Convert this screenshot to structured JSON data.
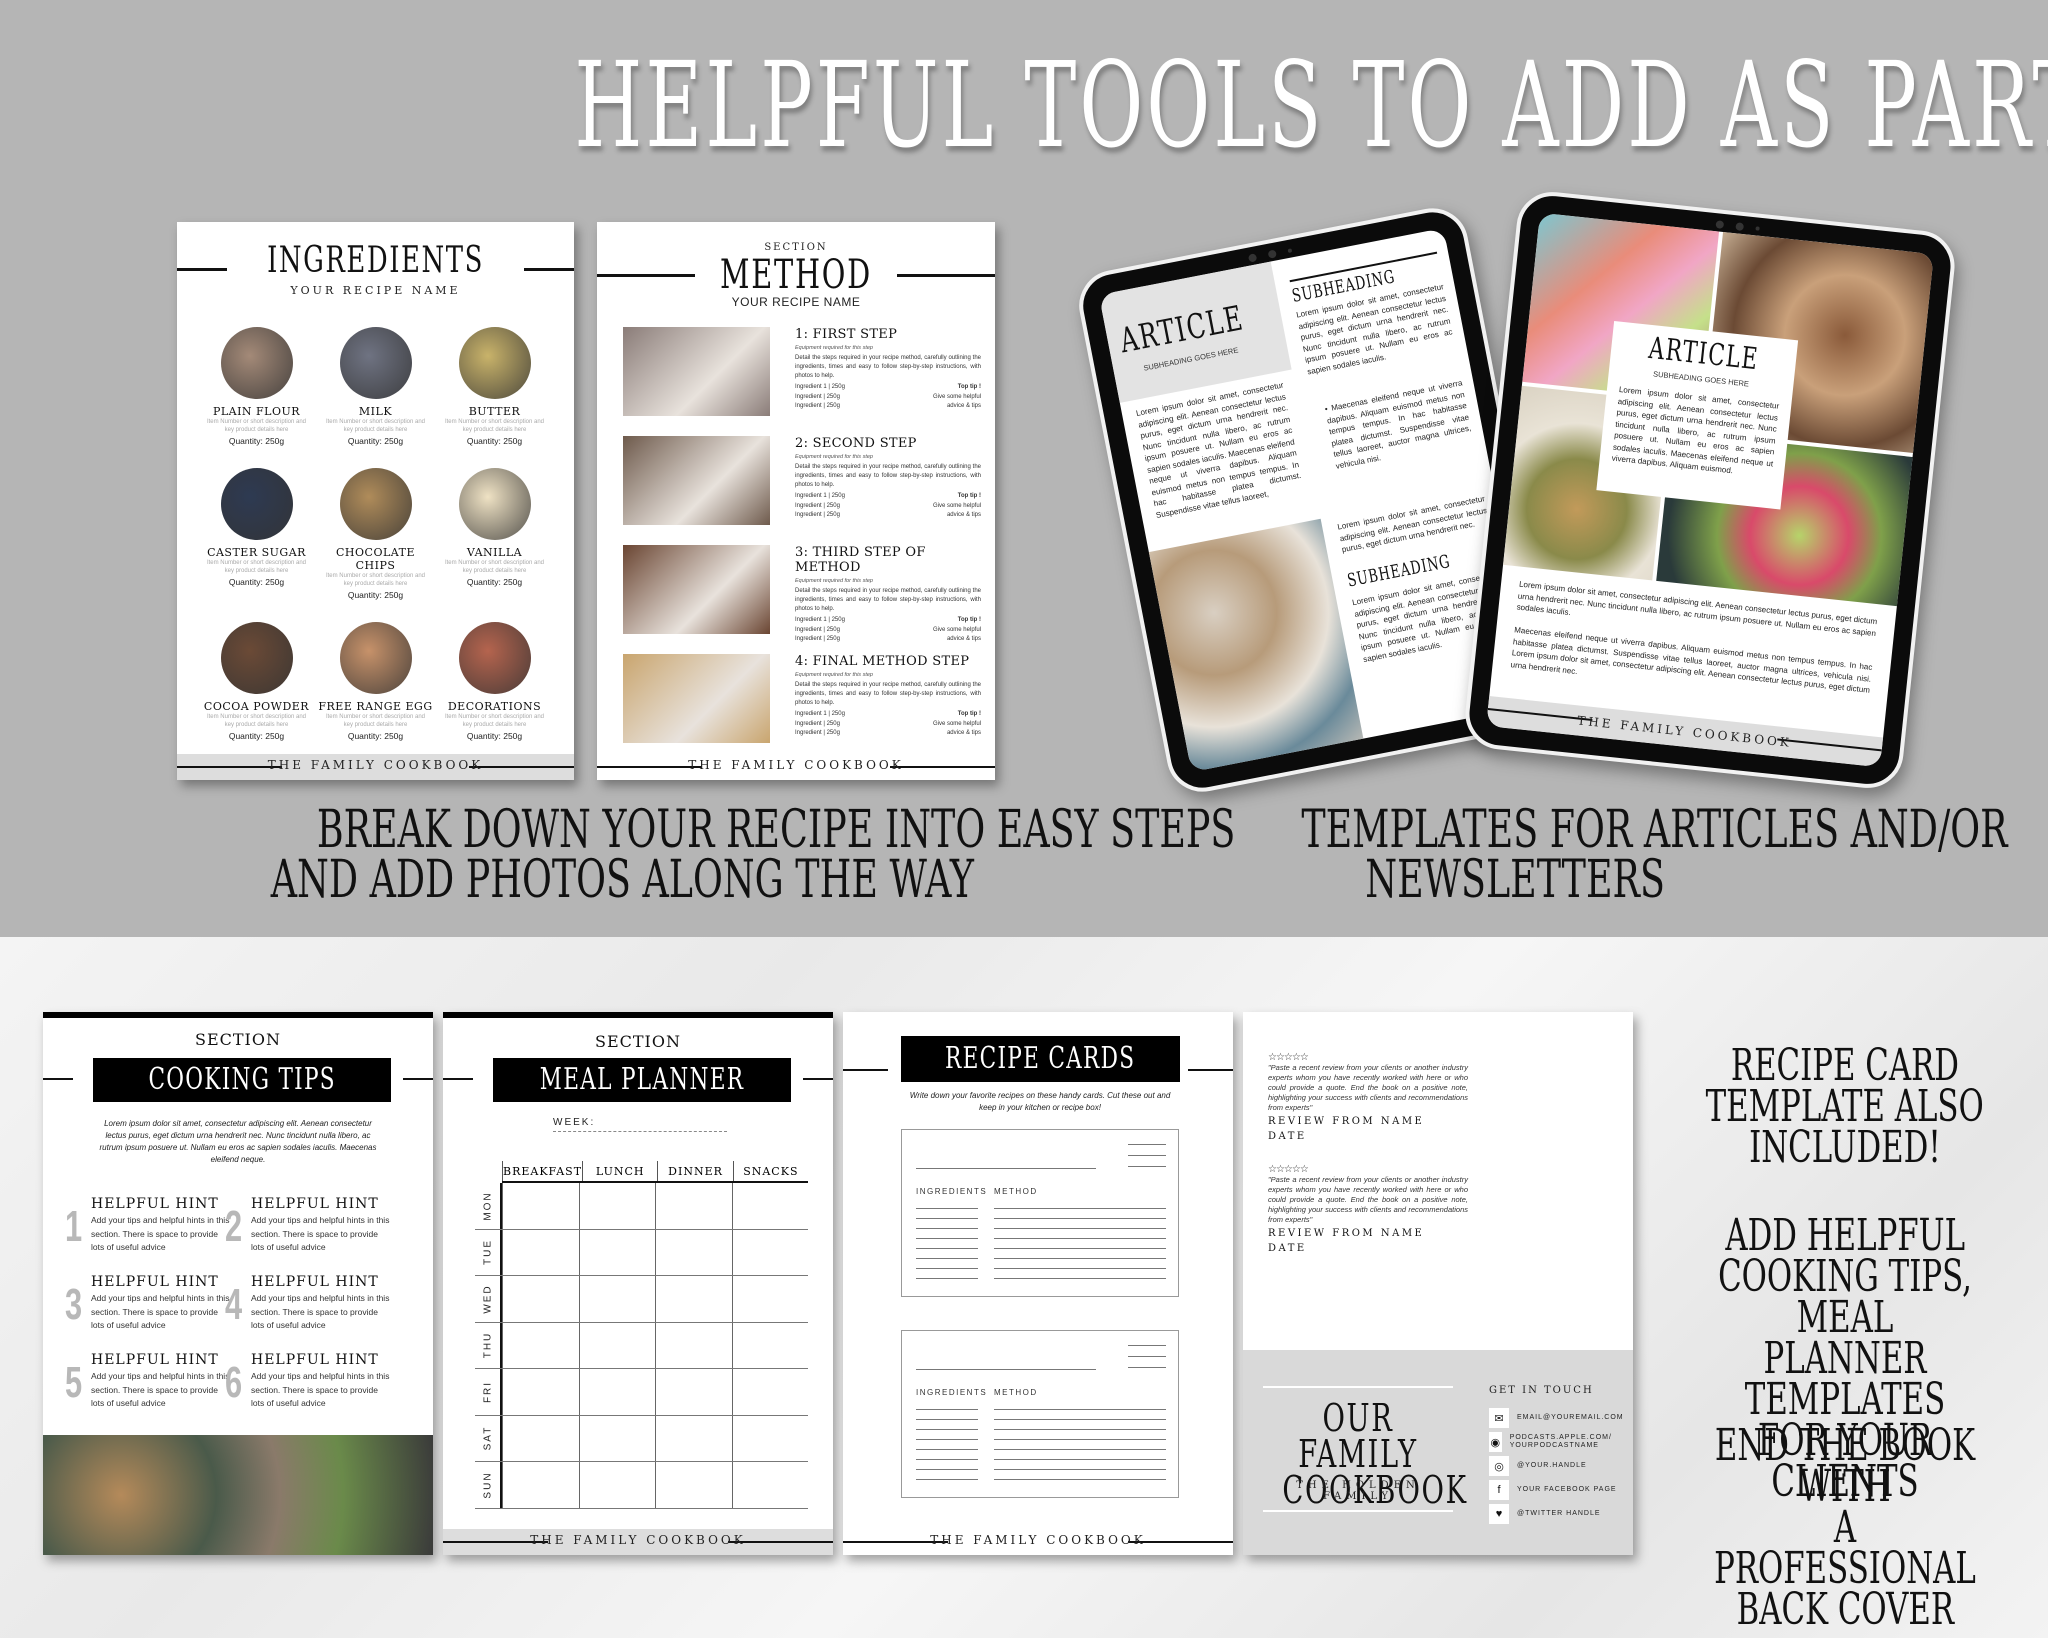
{
  "title": "HELPFUL TOOLS TO ADD AS PART OF YOUR BOOK",
  "footer_label": "THE FAMILY COOKBOOK",
  "ingredients_page": {
    "heading": "INGREDIENTS",
    "subheading": "YOUR RECIPE NAME",
    "desc": "Item Number or short description and key product details here",
    "items": [
      {
        "name": "PLAIN FLOUR",
        "quantity": "Quantity: 250g",
        "color": "#a48a78"
      },
      {
        "name": "MILK",
        "quantity": "Quantity: 250g",
        "color": "#6f7382"
      },
      {
        "name": "BUTTER",
        "quantity": "Quantity: 250g",
        "color": "#c9b36a"
      },
      {
        "name": "CASTER SUGAR",
        "quantity": "Quantity: 250g",
        "color": "#2e3a52"
      },
      {
        "name": "CHOCOLATE CHIPS",
        "quantity": "Quantity: 250g",
        "color": "#b08c5a"
      },
      {
        "name": "VANILLA",
        "quantity": "Quantity: 250g",
        "color": "#efe2c4"
      },
      {
        "name": "COCOA POWDER",
        "quantity": "Quantity: 250g",
        "color": "#6b4a36"
      },
      {
        "name": "FREE RANGE EGG",
        "quantity": "Quantity: 250g",
        "color": "#c7926a"
      },
      {
        "name": "DECORATIONS",
        "quantity": "Quantity: 250g",
        "color": "#b5644e"
      }
    ]
  },
  "method_page": {
    "section_label": "SECTION",
    "heading": "METHOD",
    "subheading": "YOUR RECIPE NAME",
    "equipment": "Equipment required for this step",
    "detail": "Detail the steps required in your recipe method, carefully outlining the ingredients, times and easy to follow step-by-step instructions, with photos to help.",
    "ingredient_lines": [
      "Ingredient 1 | 250g",
      "Ingredient | 250g",
      "Ingredient | 250g"
    ],
    "tip_lines": [
      "Top tip !",
      "Give some helpful",
      "advice & tips"
    ],
    "steps": [
      {
        "title": "1: FIRST STEP",
        "color": "#8a7c78"
      },
      {
        "title": "2: SECOND STEP",
        "color": "#6e5a4c"
      },
      {
        "title": "3: THIRD STEP OF METHOD",
        "color": "#6a4532"
      },
      {
        "title": "4: FINAL METHOD STEP",
        "color": "#c9a56e"
      }
    ]
  },
  "caption_left": [
    "BREAK DOWN YOUR RECIPE INTO EASY STEPS",
    "AND ADD PHOTOS ALONG THE WAY"
  ],
  "caption_right": [
    "TEMPLATES FOR ARTICLES AND/OR",
    "NEWSLETTERS"
  ],
  "tablet_left": {
    "heading": "ARTICLE",
    "subheading": "SUBHEADING GOES HERE",
    "body": "Lorem ipsum dolor sit amet, consectetur adipiscing elit. Aenean consectetur lectus purus, eget dictum urna hendrerit nec. Nunc tincidunt nulla libero, ac rutrum ipsum posuere ut. Nullam eu eros ac sapien sodales iaculis. Maecenas eleifend neque ut viverra dapibus. Aliquam euismod metus non tempus tempus. In hac habitasse platea dictumst. Suspendisse vitae tellus laoreet,",
    "subheading_2": "SUBHEADING",
    "col2_body": "Lorem ipsum dolor sit amet, consectetur adipiscing elit. Aenean consectetur lectus purus, eget dictum urna hendrerit nec. Nunc tincidunt nulla libero, ac rutrum ipsum posuere ut. Nullam eu eros ac sapien sodales iaculis.",
    "bullet": "Maecenas eleifend neque ut viverra dapibus. Aliquam euismod metus non tempus tempus. In hac habitasse platea dictumst. Suspendisse vitae tellus laoreet, auctor magna ultrices, vehicula nisi.",
    "col2_body_2": "Lorem ipsum dolor sit amet, consectetur adipiscing elit. Aenean consectetur lectus purus, eget dictum urna hendrerit nec.",
    "subheading_3": "SUBHEADING",
    "footer_partial": "COOK"
  },
  "tablet_right": {
    "heading": "ARTICLE",
    "subheading": "SUBHEADING GOES HERE",
    "box_body": "Lorem ipsum dolor sit amet, consectetur adipiscing elit. Aenean consectetur lectus purus, eget dictum urna hendrerit nec. Nunc tincidunt nulla libero, ac rutrum ipsum posuere ut. Nullam eu eros ac sapien sodales iaculis. Maecenas eleifend neque ut viverra dapibus. Aliquam euismod.",
    "para_1": "Lorem ipsum dolor sit amet, consectetur adipiscing elit. Aenean consectetur lectus purus, eget dictum urna hendrerit nec. Nunc tincidunt nulla libero, ac rutrum ipsum posuere ut. Nullam eu eros ac sapien sodales iaculis.",
    "para_2": "Maecenas eleifend neque ut viverra dapibus. Aliquam euismod metus non tempus tempus. In hac habitasse platea dictumst. Suspendisse vitae tellus laoreet, auctor magna ultrices, vehicula nisi. Lorem ipsum dolor sit amet, consectetur adipiscing elit. Aenean consectetur lectus purus, eget dictum urna hendrerit nec."
  },
  "cooking_tips": {
    "section_label": "SECTION",
    "heading": "COOKING TIPS",
    "intro": "Lorem ipsum dolor sit amet, consectetur adipiscing elit. Aenean consectetur lectus purus, eget dictum urna hendrerit nec. Nunc tincidunt nulla libero, ac rutrum ipsum posuere ut. Nullam eu eros ac sapien sodales iaculis. Maecenas eleifend neque.",
    "hints": [
      {
        "num": "1",
        "title": "HELPFUL HINT",
        "text": "Add your tips and helpful hints in this section. There is space to provide lots of useful advice"
      },
      {
        "num": "2",
        "title": "HELPFUL HINT",
        "text": "Add your tips and helpful hints in this section. There is space to provide lots of useful advice"
      },
      {
        "num": "3",
        "title": "HELPFUL HINT",
        "text": "Add your tips and helpful hints in this section. There is space to provide lots of useful advice"
      },
      {
        "num": "4",
        "title": "HELPFUL HINT",
        "text": "Add your tips and helpful hints in this section. There is space to provide lots of useful advice"
      },
      {
        "num": "5",
        "title": "HELPFUL HINT",
        "text": "Add your tips and helpful hints in this section. There is space to provide lots of useful advice"
      },
      {
        "num": "6",
        "title": "HELPFUL HINT",
        "text": "Add your tips and helpful hints in this section. There is space to provide lots of useful advice"
      }
    ]
  },
  "meal_planner": {
    "section_label": "SECTION",
    "heading": "MEAL PLANNER",
    "week_label": "WEEK:",
    "columns": [
      "BREAKFAST",
      "LUNCH",
      "DINNER",
      "SNACKS"
    ],
    "days": [
      "MON",
      "TUE",
      "WED",
      "THU",
      "FRI",
      "SAT",
      "SUN"
    ]
  },
  "recipe_cards": {
    "heading": "RECIPE CARDS",
    "intro": "Write down your favorite recipes on these handy cards. Cut these out and keep in your kitchen or recipe box!",
    "ingredients_label": "INGREDIENTS",
    "method_label": "METHOD"
  },
  "back_cover": {
    "reviews": [
      {
        "stars": "☆☆☆☆☆",
        "quote": "\"Paste a recent review from your clients or another industry experts whom you have recently worked with here or who could provide a quote. End the book on a positive note, highlighting your success with clients and recommendations from experts\"",
        "by": "REVIEW FROM NAME",
        "date": "DATE"
      },
      {
        "stars": "☆☆☆☆☆",
        "quote": "\"Paste a recent review from your clients or another industry experts whom you have recently worked with here or who could provide a quote. End the book on a positive note, highlighting your success with clients and recommendations from experts\"",
        "by": "REVIEW FROM NAME",
        "date": "DATE"
      }
    ],
    "book_title_1": "OUR FAMILY",
    "book_title_2": "COOKBOOK",
    "family": "THE HOLDEN FAMILY",
    "contact_heading": "GET IN TOUCH",
    "contacts": [
      {
        "icon": "email-icon",
        "glyph": "✉",
        "text": "EMAIL@YOUREMAIL.COM"
      },
      {
        "icon": "podcast-icon",
        "glyph": "◉",
        "text": "PODCASTS.APPLE.COM/ YOURPODCASTNAME"
      },
      {
        "icon": "instagram-icon",
        "glyph": "◎",
        "text": "@YOUR.HANDLE"
      },
      {
        "icon": "facebook-icon",
        "glyph": "f",
        "text": "YOUR FACEBOOK PAGE"
      },
      {
        "icon": "twitter-icon",
        "glyph": "♥",
        "text": "@TWITTER HANDLE"
      }
    ]
  },
  "side_text": {
    "block_1": [
      "RECIPE CARD",
      "TEMPLATE ALSO",
      "INCLUDED!"
    ],
    "block_2": [
      "ADD HELPFUL",
      "COOKING TIPS, MEAL",
      "PLANNER TEMPLATES",
      "FOR YOUR CLIENTS"
    ],
    "block_3": [
      "END THE BOOK WITH",
      "A PROFESSIONAL",
      "BACK COVER"
    ]
  }
}
